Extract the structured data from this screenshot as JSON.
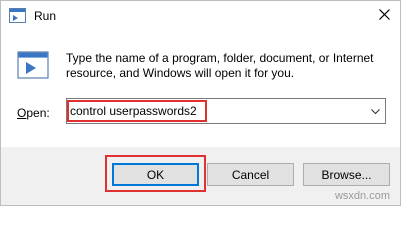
{
  "window": {
    "title": "Run"
  },
  "prompt": {
    "line1": "Type the name of a program, folder, document, or Internet",
    "line2": "resource, and Windows will open it for you."
  },
  "open_field": {
    "label_underlined": "O",
    "label_rest": "pen:",
    "value": "control userpasswords2"
  },
  "buttons": {
    "ok": "OK",
    "cancel": "Cancel",
    "browse": "Browse..."
  },
  "icons": {
    "app": "run-icon",
    "close": "close-icon",
    "dropdown": "chevron-down-icon"
  },
  "colors": {
    "highlight": "#e03030",
    "default_button_border": "#0078d7"
  },
  "watermark": "wsxdn.com"
}
